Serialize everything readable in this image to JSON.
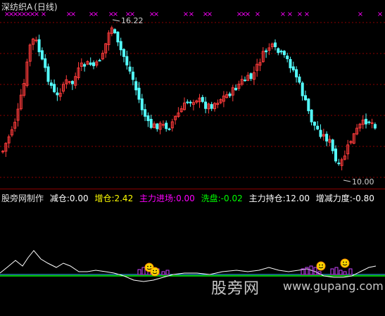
{
  "title": {
    "stock_name": "深纺织A",
    "period": "(日线)"
  },
  "price_labels": {
    "high": "16.22",
    "low": "10.00"
  },
  "indicator": {
    "name": "股旁网制作",
    "items": [
      {
        "label": "减仓:",
        "value": "0.00",
        "color": "#ffffff"
      },
      {
        "label": "增仓:",
        "value": "2.42",
        "color": "#ffff00"
      },
      {
        "label": "主力进场:",
        "value": "0.00",
        "color": "#ff00ff"
      },
      {
        "label": "洗盘:",
        "value": "-0.02",
        "color": "#00ff00"
      },
      {
        "label": "主力持仓:",
        "value": "12.00",
        "color": "#ffffff"
      },
      {
        "label": "增减力度:",
        "value": "-0.80",
        "color": "#ffffff"
      }
    ]
  },
  "watermark": {
    "text": "股旁网",
    "url": "www.gupang.com"
  },
  "colors": {
    "up": "#ff3b3b",
    "down": "#54ffff",
    "grid": "#8b0000",
    "marker": "#ff00ff",
    "label": "#d0d0d0",
    "title": "#e0e0e0"
  },
  "icons": [
    "x-marker-icon",
    "smiley-icon"
  ]
}
